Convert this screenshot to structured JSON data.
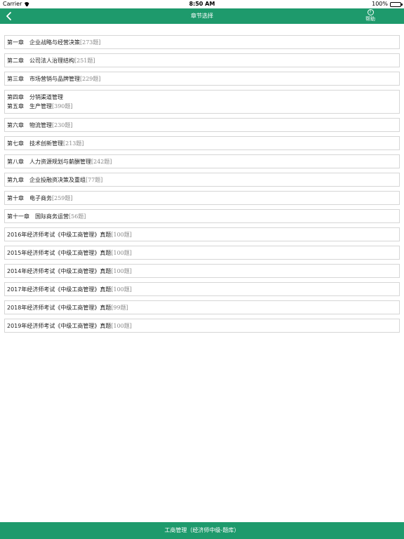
{
  "status_bar": {
    "carrier": "Carrier",
    "time": "8:50 AM",
    "battery": "100%",
    "battery_level": 1.0
  },
  "nav": {
    "title": "章节选择",
    "help_icon_glyph": "?",
    "help_label": "帮助"
  },
  "chapters": [
    {
      "lines": [
        {
          "title": "第一章　企业战略与经营决策",
          "count": "[273题]"
        }
      ]
    },
    {
      "lines": [
        {
          "title": "第二章　公司法人治理结构",
          "count": "[251题]"
        }
      ]
    },
    {
      "lines": [
        {
          "title": "第三章　市场营销与品牌管理",
          "count": "[229题]"
        }
      ]
    },
    {
      "lines": [
        {
          "title": "第四章　分销渠道管理",
          "count": ""
        },
        {
          "title": "第五章　生产管理",
          "count": "[390题]"
        }
      ]
    },
    {
      "lines": [
        {
          "title": "第六章　物流管理",
          "count": "[230题]"
        }
      ]
    },
    {
      "lines": [
        {
          "title": "第七章　技术创新管理",
          "count": "[213题]"
        }
      ]
    },
    {
      "lines": [
        {
          "title": "第八章　人力资源规划与薪酬管理",
          "count": "[242题]"
        }
      ]
    },
    {
      "lines": [
        {
          "title": "第九章　企业投融资决策及重组",
          "count": "[77题]"
        }
      ]
    },
    {
      "lines": [
        {
          "title": "第十章　电子商务",
          "count": "[259题]"
        }
      ]
    },
    {
      "lines": [
        {
          "title": "第十一章　国际商务运营",
          "count": "[56题]"
        }
      ]
    },
    {
      "lines": [
        {
          "title": "2016年经济师考试《中级工商管理》真题",
          "count": "[100题]"
        }
      ]
    },
    {
      "lines": [
        {
          "title": "2015年经济师考试《中级工商管理》真题",
          "count": "[100题]"
        }
      ]
    },
    {
      "lines": [
        {
          "title": "2014年经济师考试《中级工商管理》真题",
          "count": "[100题]"
        }
      ]
    },
    {
      "lines": [
        {
          "title": "2017年经济师考试《中级工商管理》真题",
          "count": "[100题]"
        }
      ]
    },
    {
      "lines": [
        {
          "title": "2018年经济师考试《中级工商管理》真题",
          "count": "[99题]"
        }
      ]
    },
    {
      "lines": [
        {
          "title": "2019年经济师考试《中级工商管理》真题",
          "count": "[100题]"
        }
      ]
    }
  ],
  "footer": {
    "text": "工商管理（经济师中级-题库）"
  },
  "colors": {
    "accent": "#1e9a6c",
    "border": "#d6d6d6",
    "count_text": "#888888"
  },
  "icons": {
    "back": "chevron-left-icon",
    "help": "question-circle-icon",
    "wifi": "wifi-icon",
    "battery": "battery-icon"
  }
}
